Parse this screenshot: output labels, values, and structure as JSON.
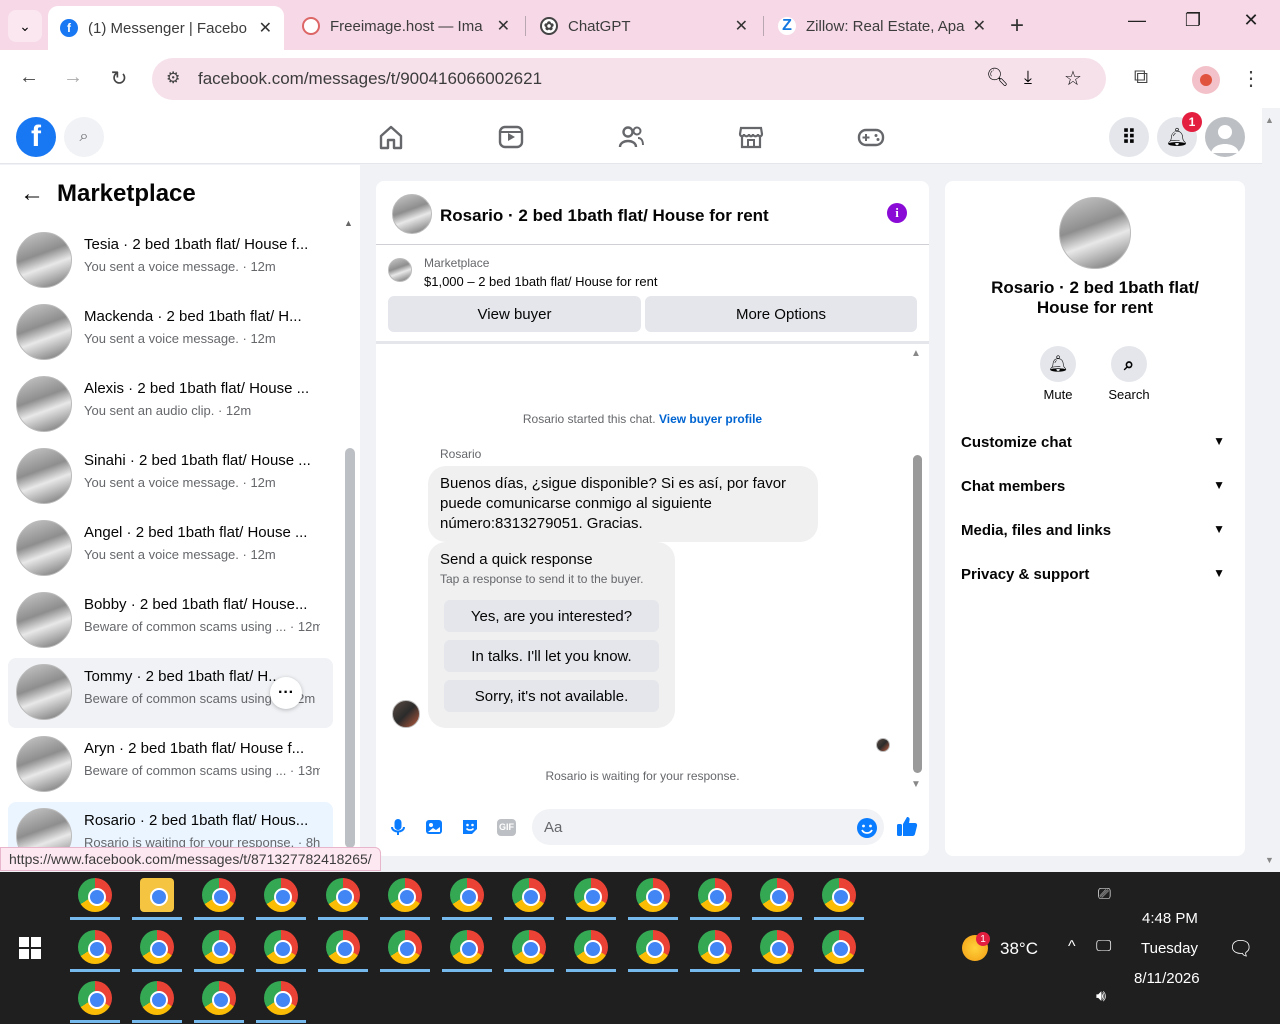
{
  "browser": {
    "tabs": [
      {
        "title": "(1) Messenger | Facebo",
        "active": true
      },
      {
        "title": "Freeimage.host — Ima",
        "active": false
      },
      {
        "title": "ChatGPT",
        "active": false
      },
      {
        "title": "Zillow: Real Estate, Apa",
        "active": false
      }
    ],
    "url": "facebook.com/messages/t/900416066002621",
    "status_url": "https://www.facebook.com/messages/t/871327782418265/"
  },
  "fb": {
    "notification_count": "1"
  },
  "sidebar": {
    "title": "Marketplace",
    "items": [
      {
        "name": "Tesia · 2 bed 1bath flat/ House f...",
        "sub": "You sent a voice message. · 12m"
      },
      {
        "name": "Mackenda · 2 bed 1bath flat/ H...",
        "sub": "You sent a voice message. · 12m"
      },
      {
        "name": "Alexis · 2 bed 1bath flat/ House ...",
        "sub": "You sent an audio clip. · 12m"
      },
      {
        "name": "Sinahi · 2 bed 1bath flat/ House ...",
        "sub": "You sent a voice message. · 12m"
      },
      {
        "name": "Angel · 2 bed 1bath flat/ House ...",
        "sub": "You sent a voice message. · 12m"
      },
      {
        "name": "Bobby · 2 bed 1bath flat/ House...",
        "sub": "Beware of common scams using ... · 12m"
      },
      {
        "name": "Tommy · 2 bed 1bath flat/ H...",
        "sub": "Beware of common scams using ... 12m"
      },
      {
        "name": "Aryn · 2 bed 1bath flat/ House f...",
        "sub": "Beware of common scams using ... · 13m"
      },
      {
        "name": "Rosario · 2 bed 1bath flat/ Hous...",
        "sub": "Rosario is waiting for your response. · 8h"
      }
    ]
  },
  "chat": {
    "title": "Rosario · 2 bed 1bath flat/ House for rent",
    "listing_label": "Marketplace",
    "listing_price": "$1,000 – 2 bed 1bath flat/ House for rent",
    "view_buyer": "View buyer",
    "more_options": "More Options",
    "started_text": "Rosario started this chat.",
    "view_profile": "View buyer profile",
    "sender": "Rosario",
    "message": "Buenos días, ¿sigue disponible? Si es así, por favor puede comunicarse conmigo al siguiente número:8313279051. Gracias.",
    "quick_title": "Send a quick response",
    "quick_sub": "Tap a response to send it to the buyer.",
    "quick_options": [
      "Yes, are you interested?",
      "In talks. I'll let you know.",
      "Sorry, it's not available."
    ],
    "waiting": "Rosario is waiting for your response.",
    "composer_placeholder": "Aa"
  },
  "details": {
    "name": "Rosario · 2 bed 1bath flat/ House for rent",
    "mute": "Mute",
    "search": "Search",
    "sections": [
      "Customize chat",
      "Chat members",
      "Media, files and links",
      "Privacy & support"
    ]
  },
  "taskbar": {
    "weather_badge": "1",
    "temperature": "38°C",
    "time": "4:48 PM",
    "day": "Tuesday",
    "date": "8/11/2026"
  }
}
